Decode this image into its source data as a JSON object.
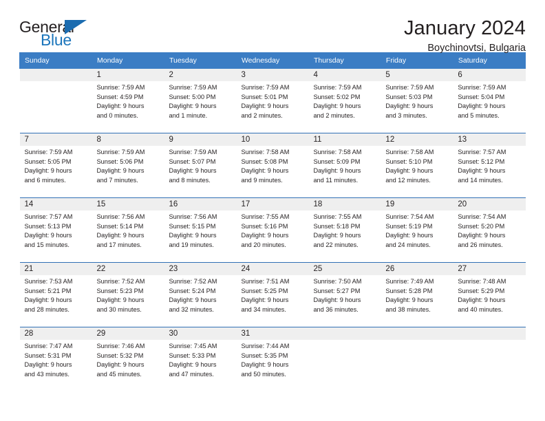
{
  "logo": {
    "word_top": "General",
    "word_bottom": "Blue",
    "triangle_color": "#1b6cb0",
    "blue_text_color": "#1b75bb"
  },
  "header": {
    "title": "January 2024",
    "subtitle": "Boychinovtsi, Bulgaria"
  },
  "theme": {
    "header_bg": "#3b7dc4",
    "daynum_bg": "#efefef",
    "rule_color": "#2f6fb5",
    "text_color": "#231f20"
  },
  "weekday_headers": [
    "Sunday",
    "Monday",
    "Tuesday",
    "Wednesday",
    "Thursday",
    "Friday",
    "Saturday"
  ],
  "weeks": [
    {
      "days": [
        {
          "num": "",
          "sunrise": "",
          "sunset": "",
          "daylight_1": "",
          "daylight_2": ""
        },
        {
          "num": "1",
          "sunrise": "Sunrise: 7:59 AM",
          "sunset": "Sunset: 4:59 PM",
          "daylight_1": "Daylight: 9 hours",
          "daylight_2": "and 0 minutes."
        },
        {
          "num": "2",
          "sunrise": "Sunrise: 7:59 AM",
          "sunset": "Sunset: 5:00 PM",
          "daylight_1": "Daylight: 9 hours",
          "daylight_2": "and 1 minute."
        },
        {
          "num": "3",
          "sunrise": "Sunrise: 7:59 AM",
          "sunset": "Sunset: 5:01 PM",
          "daylight_1": "Daylight: 9 hours",
          "daylight_2": "and 2 minutes."
        },
        {
          "num": "4",
          "sunrise": "Sunrise: 7:59 AM",
          "sunset": "Sunset: 5:02 PM",
          "daylight_1": "Daylight: 9 hours",
          "daylight_2": "and 2 minutes."
        },
        {
          "num": "5",
          "sunrise": "Sunrise: 7:59 AM",
          "sunset": "Sunset: 5:03 PM",
          "daylight_1": "Daylight: 9 hours",
          "daylight_2": "and 3 minutes."
        },
        {
          "num": "6",
          "sunrise": "Sunrise: 7:59 AM",
          "sunset": "Sunset: 5:04 PM",
          "daylight_1": "Daylight: 9 hours",
          "daylight_2": "and 5 minutes."
        }
      ]
    },
    {
      "days": [
        {
          "num": "7",
          "sunrise": "Sunrise: 7:59 AM",
          "sunset": "Sunset: 5:05 PM",
          "daylight_1": "Daylight: 9 hours",
          "daylight_2": "and 6 minutes."
        },
        {
          "num": "8",
          "sunrise": "Sunrise: 7:59 AM",
          "sunset": "Sunset: 5:06 PM",
          "daylight_1": "Daylight: 9 hours",
          "daylight_2": "and 7 minutes."
        },
        {
          "num": "9",
          "sunrise": "Sunrise: 7:59 AM",
          "sunset": "Sunset: 5:07 PM",
          "daylight_1": "Daylight: 9 hours",
          "daylight_2": "and 8 minutes."
        },
        {
          "num": "10",
          "sunrise": "Sunrise: 7:58 AM",
          "sunset": "Sunset: 5:08 PM",
          "daylight_1": "Daylight: 9 hours",
          "daylight_2": "and 9 minutes."
        },
        {
          "num": "11",
          "sunrise": "Sunrise: 7:58 AM",
          "sunset": "Sunset: 5:09 PM",
          "daylight_1": "Daylight: 9 hours",
          "daylight_2": "and 11 minutes."
        },
        {
          "num": "12",
          "sunrise": "Sunrise: 7:58 AM",
          "sunset": "Sunset: 5:10 PM",
          "daylight_1": "Daylight: 9 hours",
          "daylight_2": "and 12 minutes."
        },
        {
          "num": "13",
          "sunrise": "Sunrise: 7:57 AM",
          "sunset": "Sunset: 5:12 PM",
          "daylight_1": "Daylight: 9 hours",
          "daylight_2": "and 14 minutes."
        }
      ]
    },
    {
      "days": [
        {
          "num": "14",
          "sunrise": "Sunrise: 7:57 AM",
          "sunset": "Sunset: 5:13 PM",
          "daylight_1": "Daylight: 9 hours",
          "daylight_2": "and 15 minutes."
        },
        {
          "num": "15",
          "sunrise": "Sunrise: 7:56 AM",
          "sunset": "Sunset: 5:14 PM",
          "daylight_1": "Daylight: 9 hours",
          "daylight_2": "and 17 minutes."
        },
        {
          "num": "16",
          "sunrise": "Sunrise: 7:56 AM",
          "sunset": "Sunset: 5:15 PM",
          "daylight_1": "Daylight: 9 hours",
          "daylight_2": "and 19 minutes."
        },
        {
          "num": "17",
          "sunrise": "Sunrise: 7:55 AM",
          "sunset": "Sunset: 5:16 PM",
          "daylight_1": "Daylight: 9 hours",
          "daylight_2": "and 20 minutes."
        },
        {
          "num": "18",
          "sunrise": "Sunrise: 7:55 AM",
          "sunset": "Sunset: 5:18 PM",
          "daylight_1": "Daylight: 9 hours",
          "daylight_2": "and 22 minutes."
        },
        {
          "num": "19",
          "sunrise": "Sunrise: 7:54 AM",
          "sunset": "Sunset: 5:19 PM",
          "daylight_1": "Daylight: 9 hours",
          "daylight_2": "and 24 minutes."
        },
        {
          "num": "20",
          "sunrise": "Sunrise: 7:54 AM",
          "sunset": "Sunset: 5:20 PM",
          "daylight_1": "Daylight: 9 hours",
          "daylight_2": "and 26 minutes."
        }
      ]
    },
    {
      "days": [
        {
          "num": "21",
          "sunrise": "Sunrise: 7:53 AM",
          "sunset": "Sunset: 5:21 PM",
          "daylight_1": "Daylight: 9 hours",
          "daylight_2": "and 28 minutes."
        },
        {
          "num": "22",
          "sunrise": "Sunrise: 7:52 AM",
          "sunset": "Sunset: 5:23 PM",
          "daylight_1": "Daylight: 9 hours",
          "daylight_2": "and 30 minutes."
        },
        {
          "num": "23",
          "sunrise": "Sunrise: 7:52 AM",
          "sunset": "Sunset: 5:24 PM",
          "daylight_1": "Daylight: 9 hours",
          "daylight_2": "and 32 minutes."
        },
        {
          "num": "24",
          "sunrise": "Sunrise: 7:51 AM",
          "sunset": "Sunset: 5:25 PM",
          "daylight_1": "Daylight: 9 hours",
          "daylight_2": "and 34 minutes."
        },
        {
          "num": "25",
          "sunrise": "Sunrise: 7:50 AM",
          "sunset": "Sunset: 5:27 PM",
          "daylight_1": "Daylight: 9 hours",
          "daylight_2": "and 36 minutes."
        },
        {
          "num": "26",
          "sunrise": "Sunrise: 7:49 AM",
          "sunset": "Sunset: 5:28 PM",
          "daylight_1": "Daylight: 9 hours",
          "daylight_2": "and 38 minutes."
        },
        {
          "num": "27",
          "sunrise": "Sunrise: 7:48 AM",
          "sunset": "Sunset: 5:29 PM",
          "daylight_1": "Daylight: 9 hours",
          "daylight_2": "and 40 minutes."
        }
      ]
    },
    {
      "days": [
        {
          "num": "28",
          "sunrise": "Sunrise: 7:47 AM",
          "sunset": "Sunset: 5:31 PM",
          "daylight_1": "Daylight: 9 hours",
          "daylight_2": "and 43 minutes."
        },
        {
          "num": "29",
          "sunrise": "Sunrise: 7:46 AM",
          "sunset": "Sunset: 5:32 PM",
          "daylight_1": "Daylight: 9 hours",
          "daylight_2": "and 45 minutes."
        },
        {
          "num": "30",
          "sunrise": "Sunrise: 7:45 AM",
          "sunset": "Sunset: 5:33 PM",
          "daylight_1": "Daylight: 9 hours",
          "daylight_2": "and 47 minutes."
        },
        {
          "num": "31",
          "sunrise": "Sunrise: 7:44 AM",
          "sunset": "Sunset: 5:35 PM",
          "daylight_1": "Daylight: 9 hours",
          "daylight_2": "and 50 minutes."
        },
        {
          "num": "",
          "sunrise": "",
          "sunset": "",
          "daylight_1": "",
          "daylight_2": ""
        },
        {
          "num": "",
          "sunrise": "",
          "sunset": "",
          "daylight_1": "",
          "daylight_2": ""
        },
        {
          "num": "",
          "sunrise": "",
          "sunset": "",
          "daylight_1": "",
          "daylight_2": ""
        }
      ]
    }
  ]
}
